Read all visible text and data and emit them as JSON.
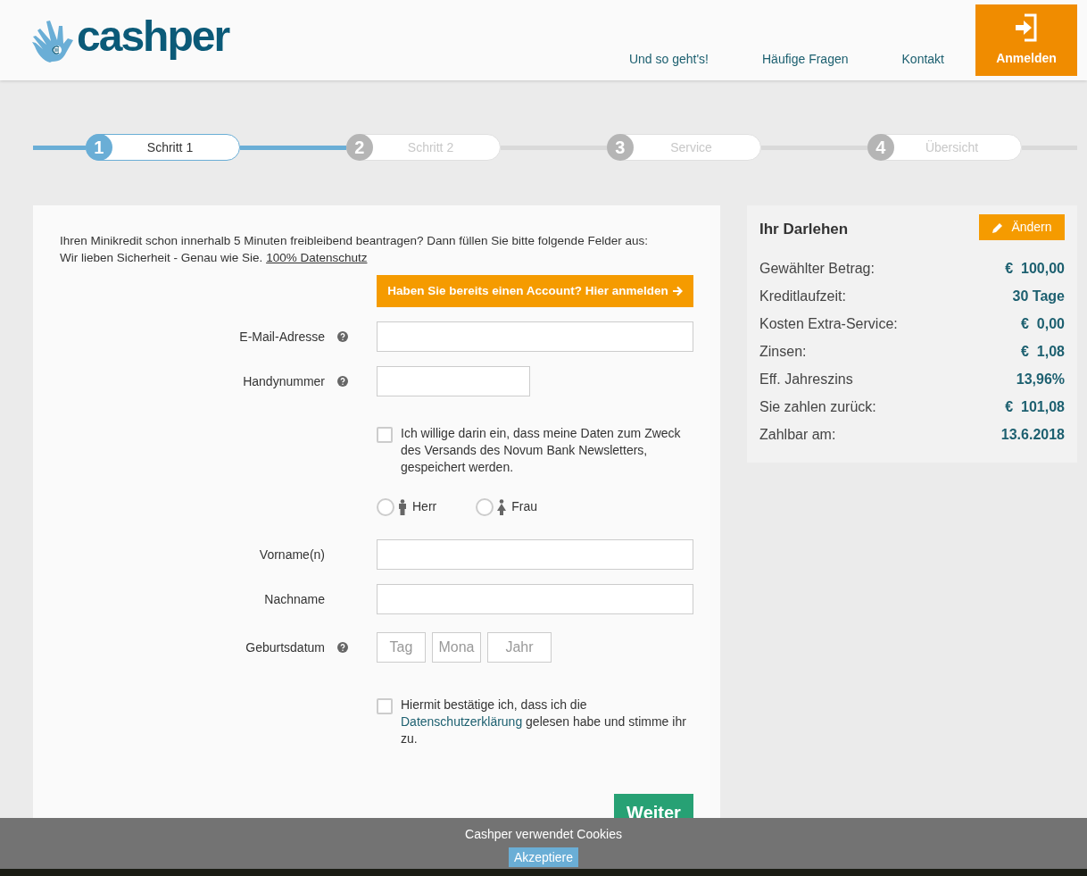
{
  "header": {
    "logo": "cashper",
    "nav": [
      "Und so geht's!",
      "Häufige Fragen",
      "Kontakt"
    ],
    "login_button": "Anmelden"
  },
  "steps": [
    {
      "number": "1",
      "label": "Schritt 1",
      "selected": true
    },
    {
      "number": "2",
      "label": "Schritt 2",
      "selected": false
    },
    {
      "number": "3",
      "label": "Service",
      "selected": false
    },
    {
      "number": "4",
      "label": "Übersicht",
      "selected": false
    }
  ],
  "form": {
    "intro": "Ihren Minikredit schon innerhalb 5 Minuten freibleibend beantragen? Dann füllen Sie bitte folgende Felder aus:",
    "intro_2": "Wir lieben Sicherheit - Genau wie Sie.",
    "intro_link": "100% Datenschutz",
    "account_button": "Haben Sie bereits einen Account? Hier anmelden",
    "fields": [
      {
        "kind": "input",
        "label": "E-Mail-Adresse",
        "help": true
      },
      {
        "kind": "short_input",
        "label": "Handynummer",
        "help": true
      },
      {
        "kind": "checkbox",
        "text": "Ich willige darin ein, dass meine Daten zum Zweck des Versands des Novum Bank Newsletters, gespeichert werden.",
        "checked": false
      },
      {
        "kind": "radio",
        "options": [
          {
            "label": "Herr",
            "selected": false
          },
          {
            "label": "Frau",
            "selected": false
          }
        ]
      },
      {
        "kind": "input",
        "label": "Vorname(n)",
        "help": false
      },
      {
        "kind": "input",
        "label": "Nachname",
        "help": false
      },
      {
        "kind": "date",
        "label": "Geburtsdatum",
        "help": true,
        "placeholders": [
          "Tag",
          "Mona",
          "Jahr"
        ]
      },
      {
        "kind": "checkbox",
        "text": "Hiermit bestätige ich, dass ich die",
        "link": "Datenschutzerklärung",
        "text_after": "gelesen habe und stimme ihr zu.",
        "checked": false
      }
    ],
    "next_button": "Weiter"
  },
  "loan": {
    "title": "Ihr Darlehen",
    "change_button": "Ändern",
    "rows": [
      {
        "label": "Gewählter Betrag:",
        "value": "€  100,00"
      },
      {
        "label": "Kreditlaufzeit:",
        "value": "30 Tage"
      },
      {
        "label": "Kosten Extra-Service:",
        "value": "€  0,00"
      },
      {
        "label": "Zinsen:",
        "value": "€  1,08"
      },
      {
        "label": "Eff. Jahreszins",
        "value": "13,96%"
      },
      {
        "label": "Sie zahlen zurück:",
        "value": "€  101,08"
      },
      {
        "label": "Zahlbar am:",
        "value": "13.6.2018"
      }
    ]
  },
  "cookie_bar": {
    "text": "Cashper verwendet Cookies",
    "button": "Akzeptiere"
  }
}
